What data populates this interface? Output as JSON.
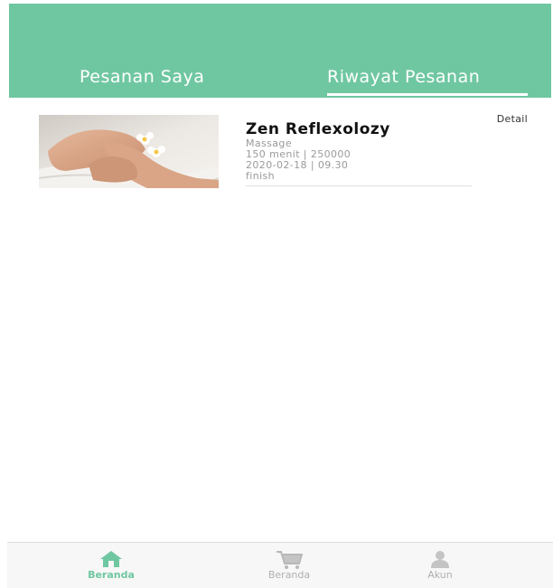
{
  "header": {
    "tabs": [
      {
        "label": "Pesanan Saya",
        "active": false
      },
      {
        "label": "Riwayat Pesanan",
        "active": true
      }
    ],
    "color": "#6fc7a1"
  },
  "orders": [
    {
      "title": "Zen Reflexolozy",
      "category": "Massage",
      "duration_price": "150 menit | 250000",
      "datetime": "2020-02-18 | 09.30",
      "status": "finish",
      "detail_label": "Detail"
    }
  ],
  "bottom_nav": {
    "items": [
      {
        "label": "Beranda",
        "icon": "home-icon",
        "active": true
      },
      {
        "label": "Beranda",
        "icon": "cart-icon",
        "active": false
      },
      {
        "label": "Akun",
        "icon": "user-icon",
        "active": false
      }
    ],
    "active_color": "#6fc7a1",
    "inactive_color": "#b0b0b0"
  }
}
